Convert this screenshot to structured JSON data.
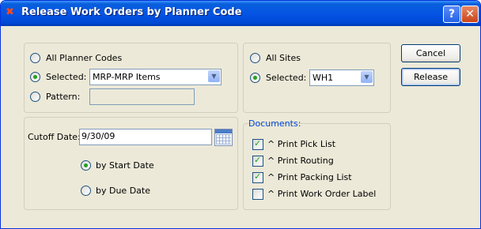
{
  "window": {
    "title": "Release Work Orders by Planner Code",
    "help_label": "?",
    "close_label": "✕"
  },
  "planner": {
    "all_label": "All Planner Codes",
    "selected_label": "Selected:",
    "selected_value": "MRP-MRP Items",
    "pattern_label": "Pattern:",
    "pattern_value": "",
    "choice": "selected"
  },
  "sites": {
    "all_label": "All Sites",
    "selected_label": "Selected:",
    "selected_value": "WH1",
    "choice": "selected"
  },
  "cutoff": {
    "label": "Cutoff Date:",
    "value": "9/30/09",
    "by_start_label": "by Start Date",
    "by_due_label": "by Due Date",
    "choice": "start"
  },
  "documents": {
    "title": "Documents:",
    "items": [
      {
        "label": "^ Print Pick List",
        "checked": true
      },
      {
        "label": "^ Print Routing",
        "checked": true
      },
      {
        "label": "^ Print Packing List",
        "checked": true
      },
      {
        "label": "^ Print Work Order Label",
        "checked": false
      }
    ]
  },
  "buttons": {
    "cancel": "Cancel",
    "release": "Release"
  },
  "colors": {
    "title_bar": "#0555E4",
    "dialog_bg": "#ECE9D8",
    "accent": "#21A121"
  }
}
